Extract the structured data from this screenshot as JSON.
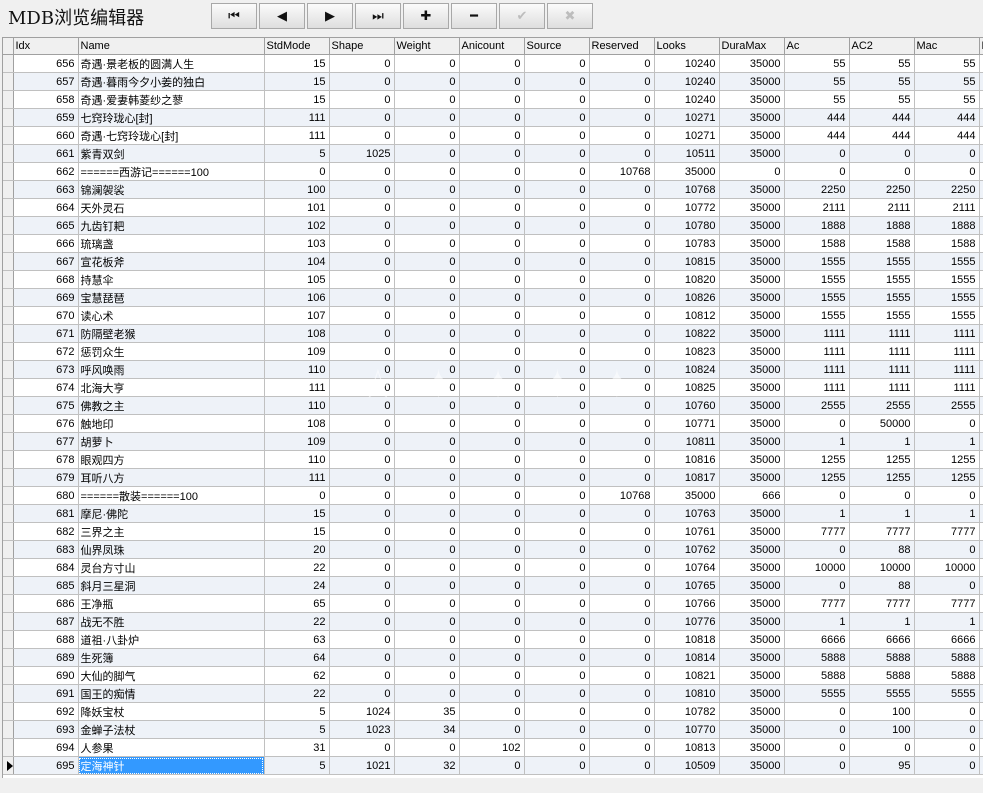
{
  "app": {
    "title": "MDB浏览编辑器"
  },
  "toolbar": {
    "buttons": [
      {
        "name": "first-record-button",
        "icon": "first-record-icon",
        "glyph": "⏮",
        "enabled": true
      },
      {
        "name": "prior-record-button",
        "icon": "prior-record-icon",
        "glyph": "◀",
        "enabled": true
      },
      {
        "name": "next-record-button",
        "icon": "next-record-icon",
        "glyph": "▶",
        "enabled": true
      },
      {
        "name": "last-record-button",
        "icon": "last-record-icon",
        "glyph": "⏭",
        "enabled": true
      },
      {
        "name": "insert-record-button",
        "icon": "plus-icon",
        "glyph": "✚",
        "enabled": true
      },
      {
        "name": "delete-record-button",
        "icon": "minus-icon",
        "glyph": "━",
        "enabled": true
      },
      {
        "name": "post-edit-button",
        "icon": "checkmark-icon",
        "glyph": "✔",
        "enabled": false
      },
      {
        "name": "cancel-edit-button",
        "icon": "cancel-x-icon",
        "glyph": "✖",
        "enabled": false
      }
    ]
  },
  "grid": {
    "columns": [
      "Idx",
      "Name",
      "StdMode",
      "Shape",
      "Weight",
      "Anicount",
      "Source",
      "Reserved",
      "Looks",
      "DuraMax",
      "Ac",
      "AC2",
      "Mac",
      "M"
    ],
    "current_row_index": 39,
    "rows": [
      [
        "656",
        "奇遇·景老板的圆满人生",
        "15",
        "0",
        "0",
        "0",
        "0",
        "0",
        "10240",
        "35000",
        "55",
        "55",
        "55"
      ],
      [
        "657",
        "奇遇·暮雨今夕小姜的独白",
        "15",
        "0",
        "0",
        "0",
        "0",
        "0",
        "10240",
        "35000",
        "55",
        "55",
        "55"
      ],
      [
        "658",
        "奇遇·爱妻韩菱纱之蓼",
        "15",
        "0",
        "0",
        "0",
        "0",
        "0",
        "10240",
        "35000",
        "55",
        "55",
        "55"
      ],
      [
        "659",
        "七窍玲珑心[封]",
        "111",
        "0",
        "0",
        "0",
        "0",
        "0",
        "10271",
        "35000",
        "444",
        "444",
        "444"
      ],
      [
        "660",
        "奇遇·七窍玲珑心[封]",
        "111",
        "0",
        "0",
        "0",
        "0",
        "0",
        "10271",
        "35000",
        "444",
        "444",
        "444"
      ],
      [
        "661",
        "紫青双剑",
        "5",
        "1025",
        "0",
        "0",
        "0",
        "0",
        "10511",
        "35000",
        "0",
        "0",
        "0"
      ],
      [
        "662",
        "======西游记======100",
        "0",
        "0",
        "0",
        "0",
        "0",
        "10768",
        "35000",
        "0",
        "0",
        "0",
        "0"
      ],
      [
        "663",
        "锦澜袈裟",
        "100",
        "0",
        "0",
        "0",
        "0",
        "0",
        "10768",
        "35000",
        "2250",
        "2250",
        "2250"
      ],
      [
        "664",
        "天外灵石",
        "101",
        "0",
        "0",
        "0",
        "0",
        "0",
        "10772",
        "35000",
        "2111",
        "2111",
        "2111"
      ],
      [
        "665",
        "九齿钉耙",
        "102",
        "0",
        "0",
        "0",
        "0",
        "0",
        "10780",
        "35000",
        "1888",
        "1888",
        "1888"
      ],
      [
        "666",
        "琉璃盏",
        "103",
        "0",
        "0",
        "0",
        "0",
        "0",
        "10783",
        "35000",
        "1588",
        "1588",
        "1588"
      ],
      [
        "667",
        "宣花板斧",
        "104",
        "0",
        "0",
        "0",
        "0",
        "0",
        "10815",
        "35000",
        "1555",
        "1555",
        "1555"
      ],
      [
        "668",
        "持慧伞",
        "105",
        "0",
        "0",
        "0",
        "0",
        "0",
        "10820",
        "35000",
        "1555",
        "1555",
        "1555"
      ],
      [
        "669",
        "宝慧琵琶",
        "106",
        "0",
        "0",
        "0",
        "0",
        "0",
        "10826",
        "35000",
        "1555",
        "1555",
        "1555"
      ],
      [
        "670",
        "读心术",
        "107",
        "0",
        "0",
        "0",
        "0",
        "0",
        "10812",
        "35000",
        "1555",
        "1555",
        "1555"
      ],
      [
        "671",
        "防隔壁老猴",
        "108",
        "0",
        "0",
        "0",
        "0",
        "0",
        "10822",
        "35000",
        "1111",
        "1111",
        "1111"
      ],
      [
        "672",
        "惩罚众生",
        "109",
        "0",
        "0",
        "0",
        "0",
        "0",
        "10823",
        "35000",
        "1111",
        "1111",
        "1111"
      ],
      [
        "673",
        "呼风唤雨",
        "110",
        "0",
        "0",
        "0",
        "0",
        "0",
        "10824",
        "35000",
        "1111",
        "1111",
        "1111"
      ],
      [
        "674",
        "北海大亨",
        "111",
        "0",
        "0",
        "0",
        "0",
        "0",
        "10825",
        "35000",
        "1111",
        "1111",
        "1111"
      ],
      [
        "675",
        "佛教之主",
        "110",
        "0",
        "0",
        "0",
        "0",
        "0",
        "10760",
        "35000",
        "2555",
        "2555",
        "2555"
      ],
      [
        "676",
        "触地印",
        "108",
        "0",
        "0",
        "0",
        "0",
        "0",
        "10771",
        "35000",
        "0",
        "50000",
        "0"
      ],
      [
        "677",
        "胡萝卜",
        "109",
        "0",
        "0",
        "0",
        "0",
        "0",
        "10811",
        "35000",
        "1",
        "1",
        "1"
      ],
      [
        "678",
        "眼观四方",
        "110",
        "0",
        "0",
        "0",
        "0",
        "0",
        "10816",
        "35000",
        "1255",
        "1255",
        "1255"
      ],
      [
        "679",
        "耳听八方",
        "111",
        "0",
        "0",
        "0",
        "0",
        "0",
        "10817",
        "35000",
        "1255",
        "1255",
        "1255"
      ],
      [
        "680",
        "======散装======100",
        "0",
        "0",
        "0",
        "0",
        "0",
        "10768",
        "35000",
        "666",
        "0",
        "0",
        "0"
      ],
      [
        "681",
        "摩尼·佛陀",
        "15",
        "0",
        "0",
        "0",
        "0",
        "0",
        "10763",
        "35000",
        "1",
        "1",
        "1"
      ],
      [
        "682",
        "三界之主",
        "15",
        "0",
        "0",
        "0",
        "0",
        "0",
        "10761",
        "35000",
        "7777",
        "7777",
        "7777"
      ],
      [
        "683",
        "仙界凤珠",
        "20",
        "0",
        "0",
        "0",
        "0",
        "0",
        "10762",
        "35000",
        "0",
        "88",
        "0"
      ],
      [
        "684",
        "灵台方寸山",
        "22",
        "0",
        "0",
        "0",
        "0",
        "0",
        "10764",
        "35000",
        "10000",
        "10000",
        "10000"
      ],
      [
        "685",
        "斜月三星洞",
        "24",
        "0",
        "0",
        "0",
        "0",
        "0",
        "10765",
        "35000",
        "0",
        "88",
        "0"
      ],
      [
        "686",
        "王净瓶",
        "65",
        "0",
        "0",
        "0",
        "0",
        "0",
        "10766",
        "35000",
        "7777",
        "7777",
        "7777"
      ],
      [
        "687",
        "战无不胜",
        "22",
        "0",
        "0",
        "0",
        "0",
        "0",
        "10776",
        "35000",
        "1",
        "1",
        "1"
      ],
      [
        "688",
        "道祖·八卦炉",
        "63",
        "0",
        "0",
        "0",
        "0",
        "0",
        "10818",
        "35000",
        "6666",
        "6666",
        "6666"
      ],
      [
        "689",
        "生死簿",
        "64",
        "0",
        "0",
        "0",
        "0",
        "0",
        "10814",
        "35000",
        "5888",
        "5888",
        "5888"
      ],
      [
        "690",
        "大仙的脚气",
        "62",
        "0",
        "0",
        "0",
        "0",
        "0",
        "10821",
        "35000",
        "5888",
        "5888",
        "5888"
      ],
      [
        "691",
        "国王的痴情",
        "22",
        "0",
        "0",
        "0",
        "0",
        "0",
        "10810",
        "35000",
        "5555",
        "5555",
        "5555"
      ],
      [
        "692",
        "降妖宝杖",
        "5",
        "1024",
        "35",
        "0",
        "0",
        "0",
        "10782",
        "35000",
        "0",
        "100",
        "0"
      ],
      [
        "693",
        "金蝉子法杖",
        "5",
        "1023",
        "34",
        "0",
        "0",
        "0",
        "10770",
        "35000",
        "0",
        "100",
        "0"
      ],
      [
        "694",
        "人参果",
        "31",
        "0",
        "0",
        "102",
        "0",
        "0",
        "10813",
        "35000",
        "0",
        "0",
        "0"
      ],
      [
        "695",
        "定海神针",
        "5",
        "1021",
        "32",
        "0",
        "0",
        "0",
        "10509",
        "35000",
        "0",
        "95",
        "0"
      ]
    ]
  },
  "colors": {
    "selection": "#3399ff",
    "alt_row": "#eef2f8",
    "header": "#f0f0f0"
  }
}
